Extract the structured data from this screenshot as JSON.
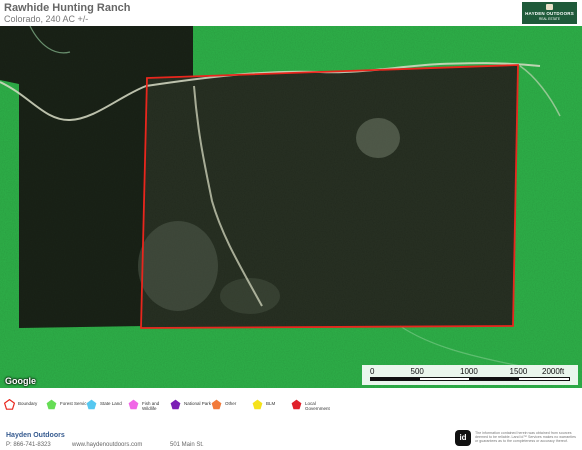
{
  "header": {
    "title": "Rawhide Hunting Ranch",
    "subtitle": "Colorado, 240 AC +/-",
    "logo_line1": "HAYDEN OUTDOORS",
    "logo_line2": "REAL ESTATE"
  },
  "map": {
    "attribution": "Google",
    "boundary_color": "#e8261d",
    "scale": {
      "labels": [
        "0",
        "500",
        "1000",
        "1500",
        "2000ft"
      ],
      "values_ft": [
        0,
        500,
        1000,
        1500,
        2000
      ]
    }
  },
  "legend": {
    "items": [
      {
        "label": "Boundary",
        "color": "#e8261d",
        "shape": "outline"
      },
      {
        "label": "Forest Servic",
        "color": "#66dd55",
        "shape": "pentagon"
      },
      {
        "label": "State Land",
        "color": "#55c7f0",
        "shape": "pentagon"
      },
      {
        "label": "Fish and Wildlife",
        "color": "#f066e6",
        "shape": "pentagon"
      },
      {
        "label": "National Park",
        "color": "#7b1fb5",
        "shape": "pentagon"
      },
      {
        "label": "Other",
        "color": "#f27a3a",
        "shape": "pentagon"
      },
      {
        "label": "BLM",
        "color": "#f5e21a",
        "shape": "pentagon"
      },
      {
        "label": "Local Government",
        "color": "#e0202a",
        "shape": "pentagon"
      }
    ]
  },
  "footer": {
    "company": "Hayden Outdoors",
    "phone": "P: 866-741-8323",
    "website": "www.haydenoutdoors.com",
    "address": "501 Main St.",
    "id_badge": "id",
    "disclaimer": "The information contained herein was obtained from sources deemed to be reliable. Land id™ Services makes no warranties or guarantees as to the completeness or accuracy thereof."
  }
}
